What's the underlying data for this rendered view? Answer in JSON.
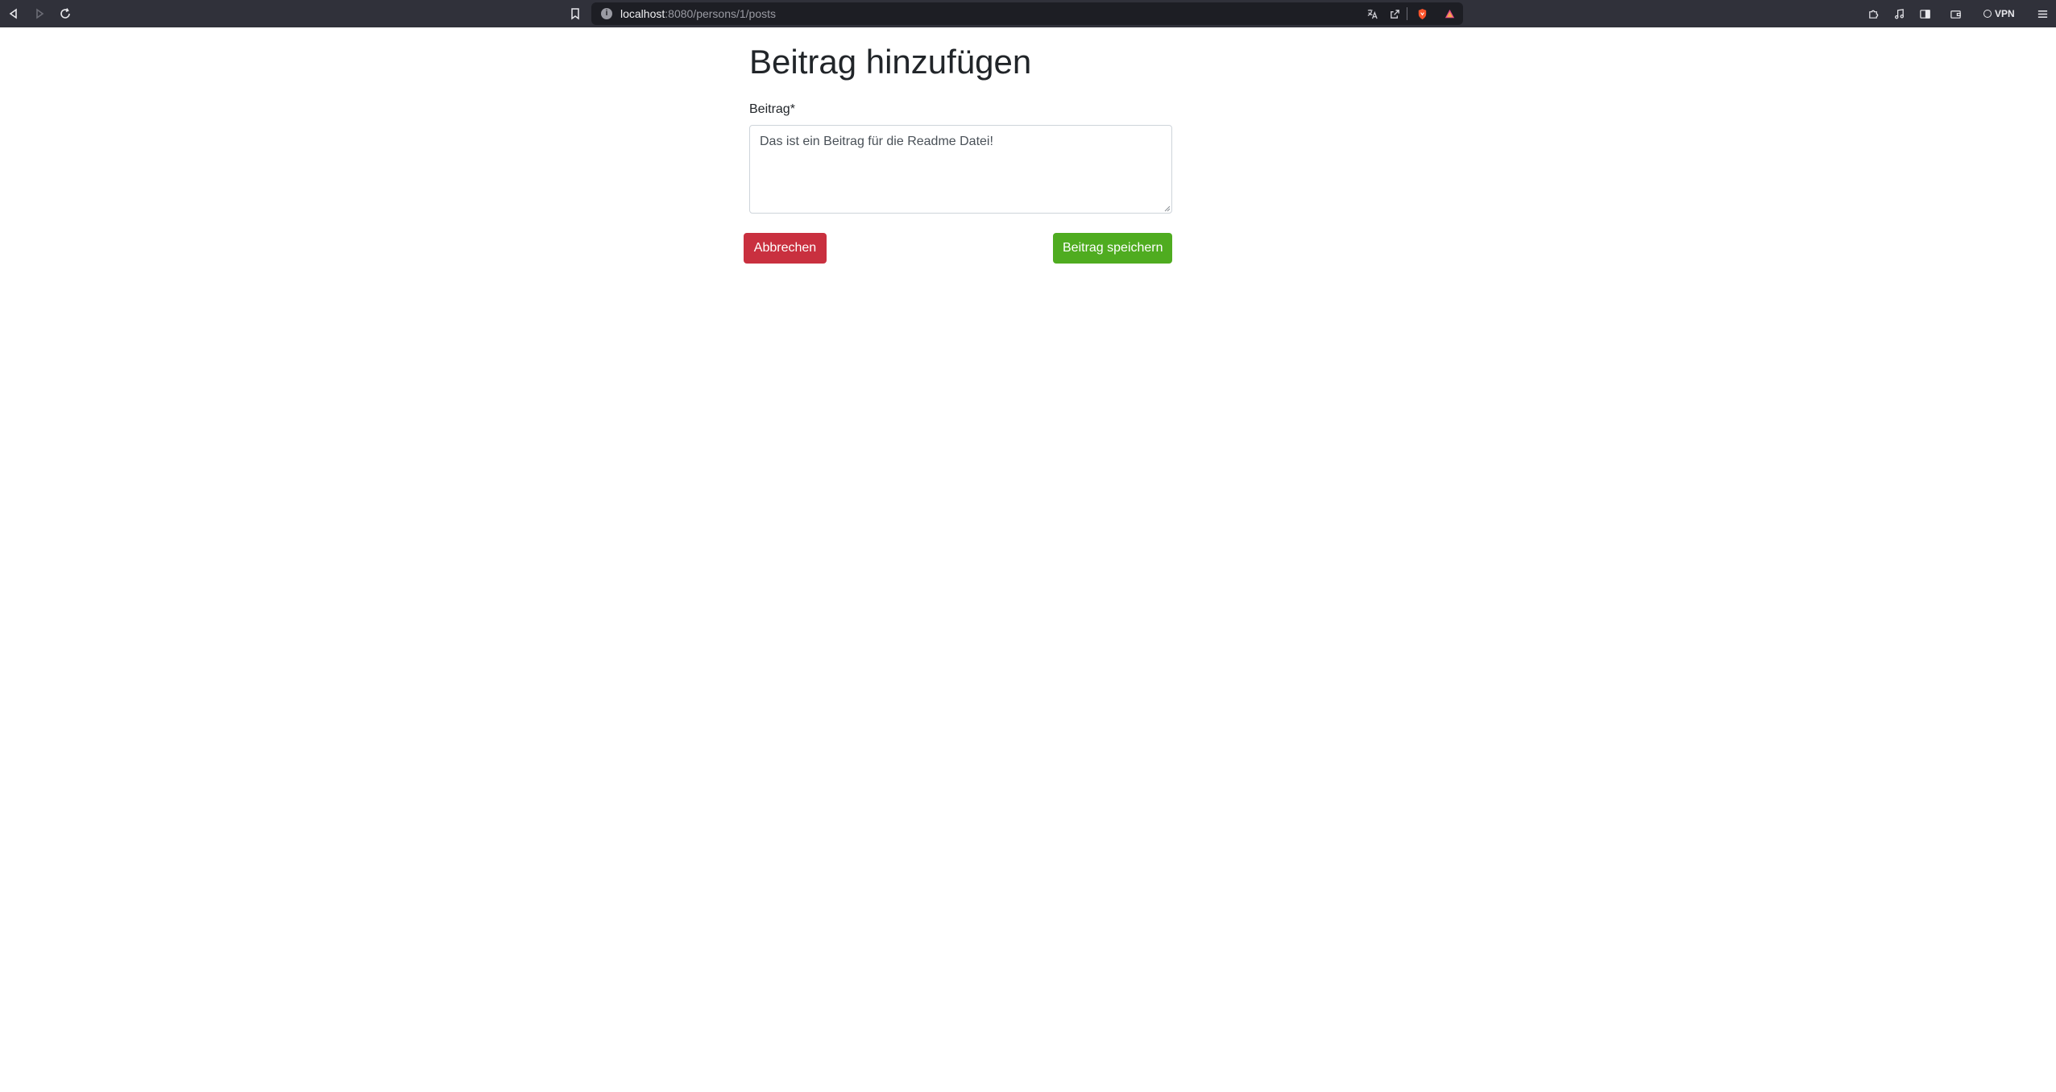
{
  "browser": {
    "url_host": "localhost",
    "url_path": ":8080/persons/1/posts",
    "vpn_label": "VPN",
    "icons": [
      "back-icon",
      "forward-icon",
      "reload-icon",
      "bookmark-icon",
      "site-info-icon",
      "translate-icon",
      "share-icon",
      "brave-shields-icon",
      "brave-rewards-icon",
      "extensions-icon",
      "media-icon",
      "sidebar-icon",
      "wallet-icon",
      "vpn-icon",
      "menu-icon"
    ]
  },
  "page": {
    "title": "Beitrag hinzufügen",
    "field_label": "Beitrag*",
    "textarea_value": "Das ist ein Beitrag für die Readme Datei!",
    "cancel_label": "Abbrechen",
    "save_label": "Beitrag speichern"
  },
  "colors": {
    "toolbar": "#30313a",
    "urlbar": "#1d1e24",
    "danger": "#c9303f",
    "success": "#4fac20"
  }
}
